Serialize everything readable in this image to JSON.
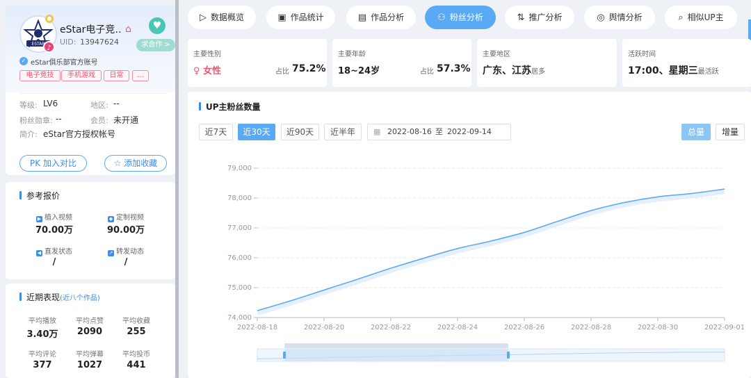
{
  "profile": {
    "name": "eStar电子竞…",
    "uid_label": "UID:",
    "uid": "13947624",
    "coop_button": "求合作 >",
    "verify_text": "eStar俱乐部官方账号",
    "avatar_text": "ESTAR",
    "tags": [
      "电子竞技",
      "手机游戏",
      "日常",
      "…"
    ],
    "level_label": "等级:",
    "level": "LV6",
    "region_label": "地区:",
    "region": "--",
    "medal_label": "粉丝勋章:",
    "medal": "--",
    "member_label": "会员:",
    "member": "未开通",
    "bio_label": "简介:",
    "bio": "eStar官方授权帐号",
    "pk_button": "PK 加入对比",
    "fav_button": "添加收藏"
  },
  "pricing": {
    "title": "参考报价",
    "items": [
      {
        "label": "植入视频",
        "value": "70.00万"
      },
      {
        "label": "定制视频",
        "value": "90.00万"
      },
      {
        "label": "直发状态",
        "value": "/"
      },
      {
        "label": "转发动态",
        "value": "/"
      }
    ]
  },
  "recent": {
    "title": "近期表现",
    "subtitle": "(近八个作品)",
    "items": [
      {
        "label": "平均播放",
        "value": "3.40万"
      },
      {
        "label": "平均点赞",
        "value": "2090"
      },
      {
        "label": "平均收藏",
        "value": "255"
      },
      {
        "label": "平均评论",
        "value": "377"
      },
      {
        "label": "平均弹幕",
        "value": "1027"
      },
      {
        "label": "平均投币",
        "value": "441"
      }
    ]
  },
  "tabs": [
    {
      "label": "数据概览",
      "icon": "play-box-icon"
    },
    {
      "label": "作品统计",
      "icon": "video-icon"
    },
    {
      "label": "作品分析",
      "icon": "chart-icon"
    },
    {
      "label": "粉丝分析",
      "icon": "user-icon"
    },
    {
      "label": "推广分析",
      "icon": "promote-icon"
    },
    {
      "label": "舆情分析",
      "icon": "globe-icon"
    },
    {
      "label": "相似UP主",
      "icon": "search-icon"
    }
  ],
  "metrics": {
    "gender": {
      "label": "主要性别",
      "value": "女性",
      "ratio_label": "占比",
      "ratio": "75.2%"
    },
    "age": {
      "label": "主要年龄",
      "value": "18~24岁",
      "ratio_label": "占比",
      "ratio": "57.3%"
    },
    "region": {
      "label": "主要地区",
      "value": "广东、江苏",
      "suffix": "居多"
    },
    "active": {
      "label": "活跃时间",
      "value": "17:00、星期三",
      "suffix": "最活跃"
    }
  },
  "chart_panel": {
    "title": "UP主粉丝数量",
    "ranges": [
      "近7天",
      "近30天",
      "近90天",
      "近半年"
    ],
    "date_start": "2022-08-16",
    "date_sep": "至",
    "date_end": "2022-09-14",
    "mode_total": "总量",
    "mode_increment": "增量"
  },
  "chart_data": {
    "type": "line",
    "title": "UP主粉丝数量",
    "x": [
      "2022-08-18",
      "2022-08-19",
      "2022-08-20",
      "2022-08-21",
      "2022-08-22",
      "2022-08-23",
      "2022-08-24",
      "2022-08-25",
      "2022-08-26",
      "2022-08-27",
      "2022-08-28",
      "2022-08-29",
      "2022-08-30",
      "2022-08-31",
      "2022-09-01"
    ],
    "x_ticks": [
      "2022-08-18",
      "2022-08-20",
      "2022-08-22",
      "2022-08-24",
      "2022-08-26",
      "2022-08-28",
      "2022-08-30",
      "2022-09-01"
    ],
    "series": [
      {
        "values": [
          74230,
          74560,
          74920,
          75280,
          75650,
          75990,
          76310,
          76560,
          76850,
          77220,
          77580,
          77850,
          78040,
          78150,
          78300
        ]
      }
    ],
    "ylim": [
      74000,
      79000
    ],
    "y_ticks": [
      "74,000",
      "75,000",
      "76,000",
      "77,000",
      "78,000",
      "79,000"
    ],
    "grid": true,
    "color": "#5aa9f5"
  }
}
